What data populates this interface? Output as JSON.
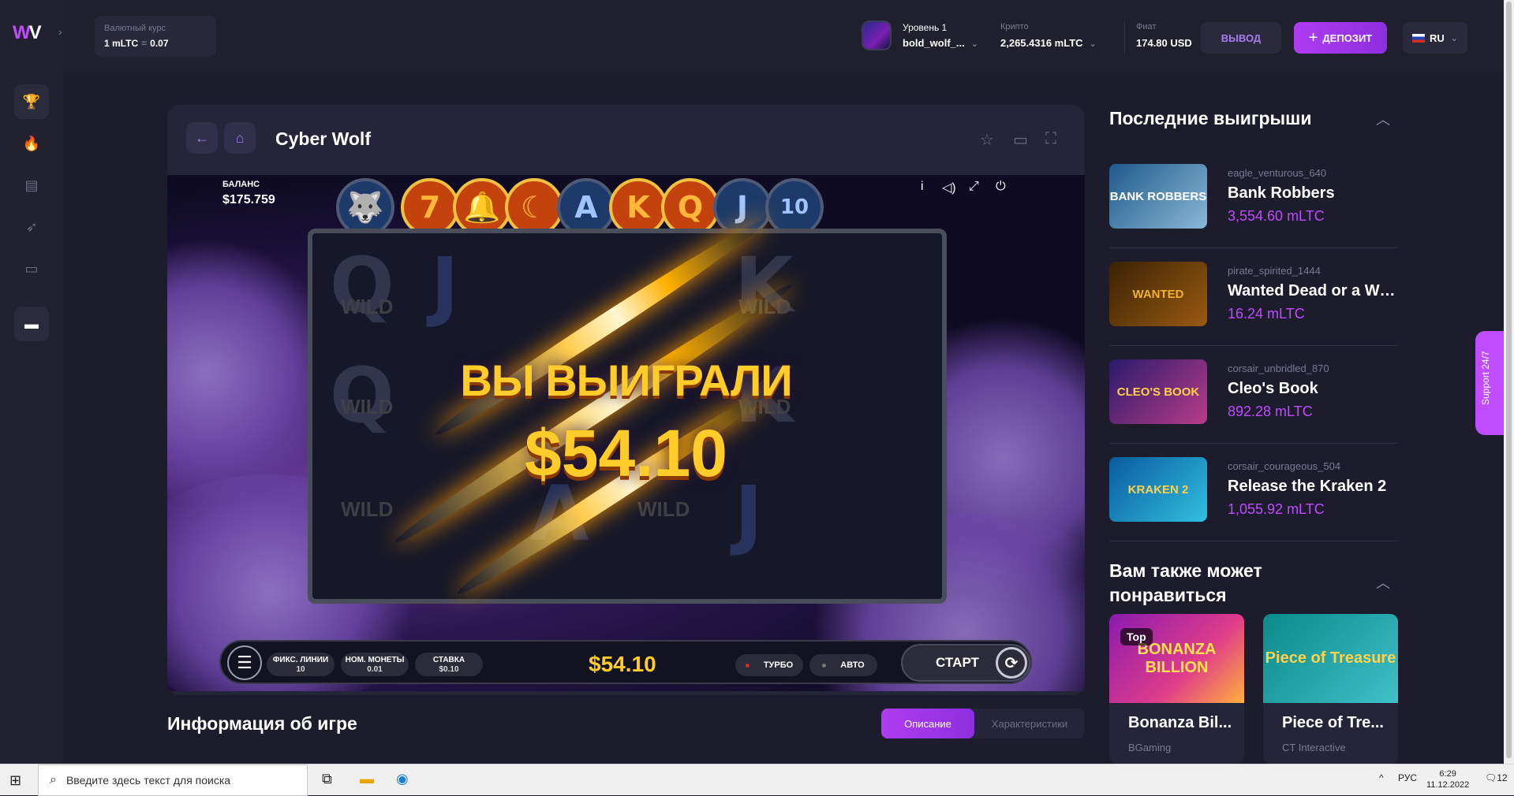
{
  "header": {
    "rate_label": "Валютный курс",
    "rate_left": "1 mLTC",
    "rate_sep": "=",
    "rate_right": "0.07",
    "level": "Уровень 1",
    "username": "bold_wolf_...",
    "crypto_label": "Крипто",
    "crypto_value": "2,265.4316 mLTC",
    "fiat_label": "Фиат",
    "fiat_value": "174.80 USD",
    "withdraw_label": "ВЫВОД",
    "deposit_label": "ДЕПОЗИТ",
    "lang": "RU"
  },
  "game": {
    "title": "Cyber Wolf",
    "balance_label": "БАЛАНС",
    "balance_value": "$175.759",
    "top_symbols": [
      "7",
      "🔔",
      "☾",
      "A",
      "K",
      "Q",
      "J",
      "10"
    ],
    "wild_text": "WILD",
    "win_title": "ВЫ ВЫИГРАЛИ",
    "win_amount": "$54.10",
    "lines_label": "ФИКС. ЛИНИИ",
    "lines_value": "10",
    "coin_label": "НОМ. МОНЕТЫ",
    "coin_value": "0.01",
    "bet_label": "СТАВКА",
    "bet_value": "$0.10",
    "bar_amount": "$54.10",
    "turbo_label": "ТУРБО",
    "auto_label": "АВТО",
    "start_label": "СТАРТ"
  },
  "info": {
    "title": "Информация об игре",
    "tab_desc": "Описание",
    "tab_spec": "Характеристики"
  },
  "recent": {
    "title": "Последние выигрыши",
    "items": [
      {
        "user": "eagle_venturous_640",
        "game": "Bank Robbers",
        "amount": "3,554.60 mLTC",
        "thumb": "BANK ROBBERS"
      },
      {
        "user": "pirate_spirited_1444",
        "game": "Wanted Dead or a Wil...",
        "amount": "16.24 mLTC",
        "thumb": "WANTED"
      },
      {
        "user": "corsair_unbridled_870",
        "game": "Cleo's Book",
        "amount": "892.28 mLTC",
        "thumb": "CLEO'S BOOK"
      },
      {
        "user": "corsair_courageous_504",
        "game": "Release the Kraken 2",
        "amount": "1,055.92 mLTC",
        "thumb": "KRAKEN 2"
      }
    ]
  },
  "recommend": {
    "title": "Вам также может понравиться",
    "cards": [
      {
        "name": "Bonanza Bil...",
        "provider": "BGaming",
        "badge": "Top",
        "img": "BONANZA BILLION"
      },
      {
        "name": "Piece of Tre...",
        "provider": "CT Interactive",
        "img": "Piece of Treasure"
      }
    ]
  },
  "support_label": "Support 24/7",
  "taskbar": {
    "search_placeholder": "Введите здесь текст для поиска",
    "lang": "РУС",
    "time": "6:29",
    "date": "11.12.2022",
    "notif": "12"
  }
}
